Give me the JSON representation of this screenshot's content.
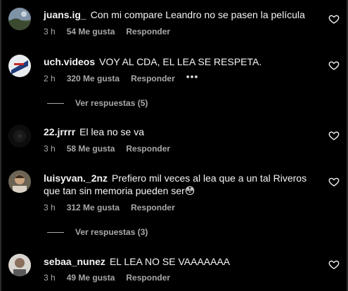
{
  "comments": [
    {
      "username": "juans.ig_",
      "text": "Con mi compare Leandro no se pasen la película",
      "time": "3 h",
      "likes": "54 Me gusta",
      "reply": "Responder"
    },
    {
      "username": "uch.videos",
      "text": "VOY AL CDA, EL LEA SE RESPETA.",
      "time": "2 h",
      "likes": "320 Me gusta",
      "reply": "Responder",
      "more": "•••",
      "view_replies": "Ver respuestas (5)"
    },
    {
      "username": "22.jrrrr",
      "text": "El lea no se va",
      "time": "3 h",
      "likes": "58 Me gusta",
      "reply": "Responder"
    },
    {
      "username": "luisyvan._2nz",
      "text": "Prefiero mil veces al lea que a un tal Riveros que tan sin memoria pueden ser😳",
      "time": "3 h",
      "likes": "312 Me gusta",
      "reply": "Responder",
      "view_replies": "Ver respuestas (3)"
    },
    {
      "username": "sebaa_nunez",
      "text": "EL LEA NO SE VAAAAAAA",
      "time": "3 h",
      "likes": "49 Me gusta",
      "reply": "Responder"
    }
  ],
  "colors": {
    "background": "#000000",
    "text": "#f5f5f5",
    "muted": "#a8a8a8"
  }
}
